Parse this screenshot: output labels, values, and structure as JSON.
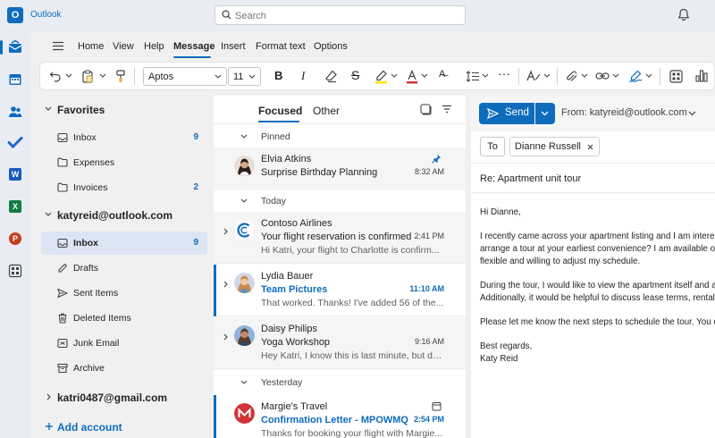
{
  "app": {
    "name": "Outlook"
  },
  "search": {
    "placeholder": "Search"
  },
  "menu": {
    "tabs": [
      "Home",
      "View",
      "Help",
      "Message",
      "Insert",
      "Format text",
      "Options"
    ],
    "active": "Message"
  },
  "ribbon": {
    "font_name": "Aptos",
    "font_size": "11"
  },
  "folders": {
    "favorites_label": "Favorites",
    "favorites": [
      {
        "label": "Inbox",
        "count": "9",
        "icon": "inbox-icon"
      },
      {
        "label": "Expenses",
        "count": "",
        "icon": "folder-icon"
      },
      {
        "label": "Invoices",
        "count": "2",
        "icon": "folder-icon"
      }
    ],
    "account1": "katyreid@outlook.com",
    "account1_folders": [
      {
        "label": "Inbox",
        "count": "9",
        "icon": "inbox-icon",
        "selected": true
      },
      {
        "label": "Drafts",
        "count": "",
        "icon": "pencil-icon"
      },
      {
        "label": "Sent Items",
        "count": "",
        "icon": "send-icon"
      },
      {
        "label": "Deleted Items",
        "count": "",
        "icon": "trash-icon"
      },
      {
        "label": "Junk Email",
        "count": "",
        "icon": "junk-icon"
      },
      {
        "label": "Archive",
        "count": "",
        "icon": "archive-icon"
      }
    ],
    "account2": "katri0487@gmail.com",
    "add_account": "Add account"
  },
  "message_list": {
    "tabs": [
      "Focused",
      "Other"
    ],
    "groups": {
      "pinned": "Pinned",
      "today": "Today",
      "yesterday": "Yesterday"
    },
    "messages": [
      {
        "sender": "Elvia Atkins",
        "subject": "Surprise Birthday Planning",
        "preview": "",
        "time": "8:32 AM"
      },
      {
        "sender": "Contoso Airlines",
        "subject": "Your flight reservation is confirmed",
        "preview": "Hi Katri, your flight to Charlotte is confirm...",
        "time": "2:41 PM"
      },
      {
        "sender": "Lydia Bauer",
        "subject": "Team Pictures",
        "preview": "That worked. Thanks! I've added 56 of the...",
        "time": "11:10 AM"
      },
      {
        "sender": "Daisy Philips",
        "subject": "Yoga Workshop",
        "preview": "Hey Katri, I know this is last minute, but do...",
        "time": "9:16 AM"
      },
      {
        "sender": "Margie's Travel",
        "subject": "Confirmation Letter - MPOWMQ",
        "preview": "Thanks for booking your flight with Margie...",
        "time": "2:54 PM"
      }
    ]
  },
  "compose": {
    "send_label": "Send",
    "from_label": "From: katyreid@outlook.com",
    "to_label": "To",
    "recipient": "Dianne Russell",
    "subject": "Re: Apartment unit tour",
    "body": {
      "greeting": "Hi Dianne,",
      "p1_l1": "I recently came across your apartment listing and I am interested",
      "p1_l2": "arrange a tour at your earliest convenience? I am available on W",
      "p1_l3": "flexible and willing to adjust my schedule.",
      "p2_l1": "During the tour, I would like to view the apartment itself and any",
      "p2_l2": "Additionally, it would be helpful to discuss lease terms, rental pr",
      "p3": "Please let me know the next steps to schedule the tour. You can",
      "closing": "Best regards,",
      "signature": "Katy Reid"
    }
  },
  "colors": {
    "accent": "#0f6cbd",
    "selected_folder": "#dbe5f3",
    "background": "#e9edf3"
  }
}
